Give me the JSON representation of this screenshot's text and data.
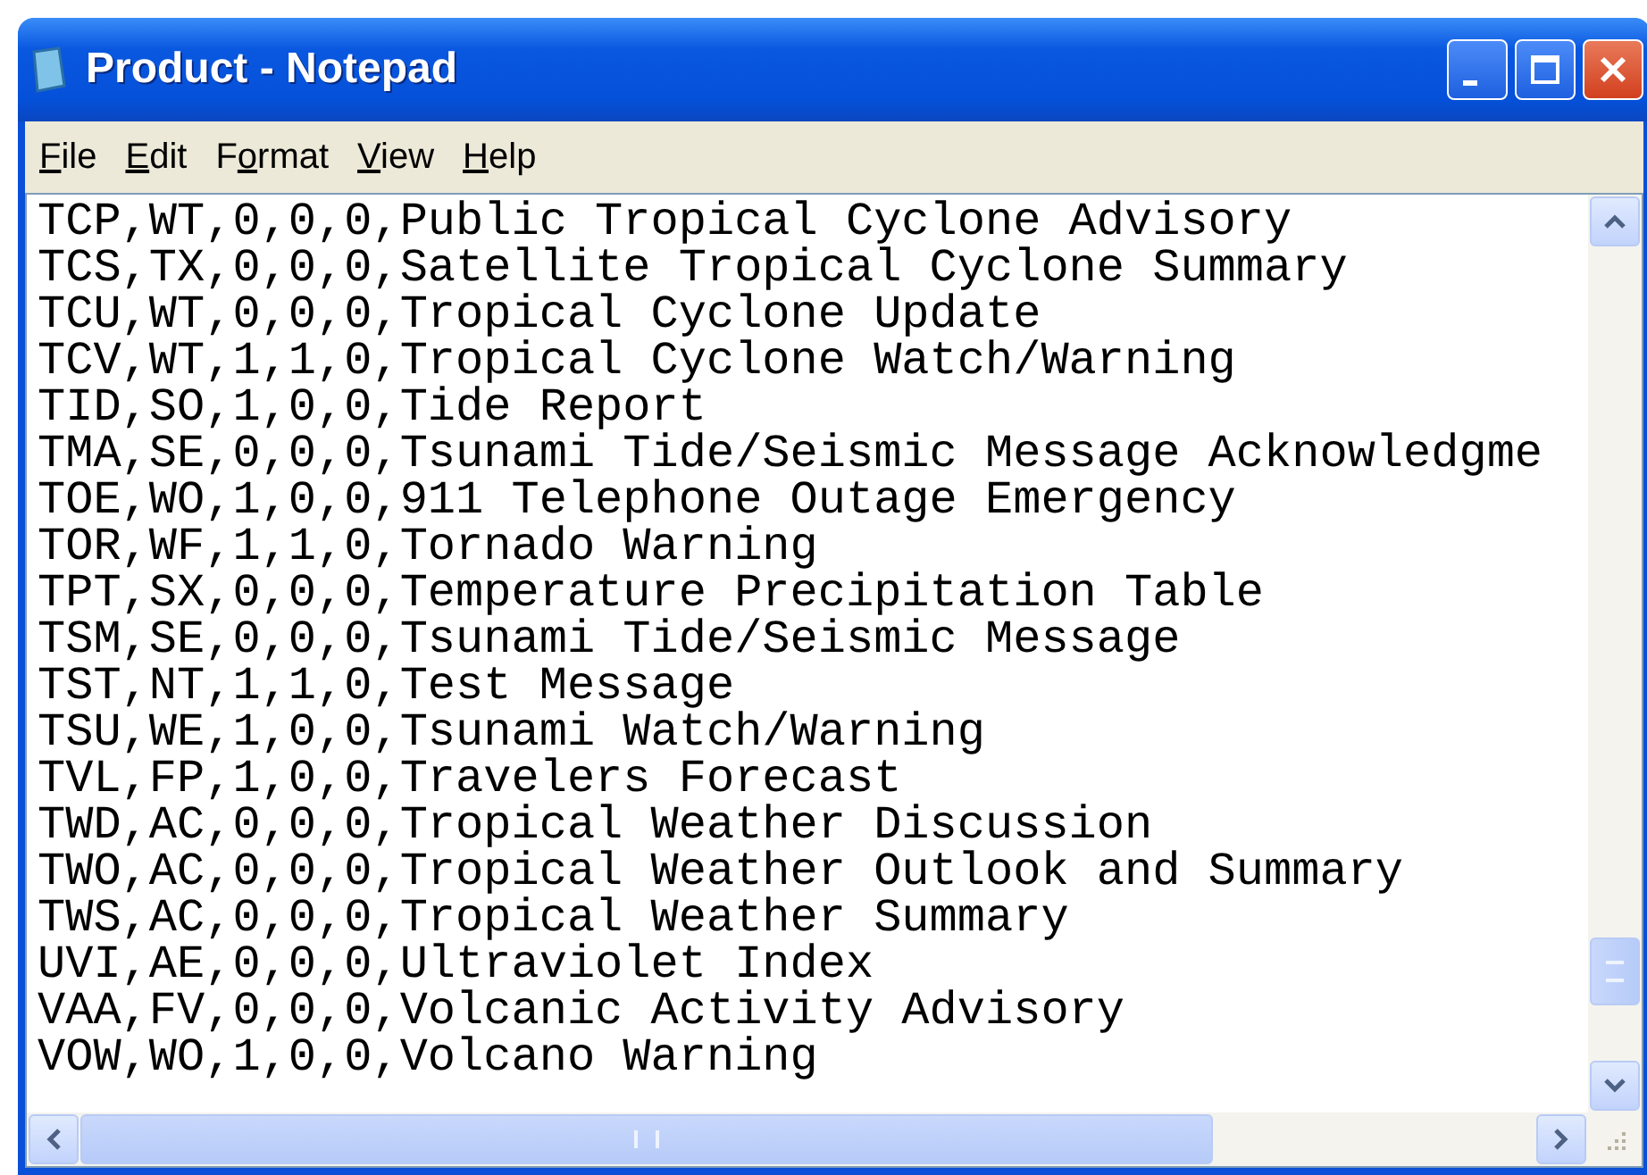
{
  "window": {
    "title": "Product - Notepad"
  },
  "menu": [
    {
      "key": "F",
      "after": "ile"
    },
    {
      "key": "E",
      "after": "dit"
    },
    {
      "before": "F",
      "key": "o",
      "after": "rmat"
    },
    {
      "key": "V",
      "after": "iew"
    },
    {
      "key": "H",
      "after": "elp"
    }
  ],
  "lines": [
    "TCP,WT,0,0,0,Public Tropical Cyclone Advisory",
    "TCS,TX,0,0,0,Satellite Tropical Cyclone Summary",
    "TCU,WT,0,0,0,Tropical Cyclone Update",
    "TCV,WT,1,1,0,Tropical Cyclone Watch/Warning",
    "TID,SO,1,0,0,Tide Report",
    "TMA,SE,0,0,0,Tsunami Tide/Seismic Message Acknowledgme",
    "TOE,WO,1,0,0,911 Telephone Outage Emergency",
    "TOR,WF,1,1,0,Tornado Warning",
    "TPT,SX,0,0,0,Temperature Precipitation Table",
    "TSM,SE,0,0,0,Tsunami Tide/Seismic Message",
    "TST,NT,1,1,0,Test Message",
    "TSU,WE,1,0,0,Tsunami Watch/Warning",
    "TVL,FP,1,0,0,Travelers Forecast",
    "TWD,AC,0,0,0,Tropical Weather Discussion",
    "TWO,AC,0,0,0,Tropical Weather Outlook and Summary",
    "TWS,AC,0,0,0,Tropical Weather Summary",
    "UVI,AE,0,0,0,Ultraviolet Index",
    "VAA,FV,0,0,0,Volcanic Activity Advisory",
    "VOW,WO,1,0,0,Volcano Warning"
  ]
}
